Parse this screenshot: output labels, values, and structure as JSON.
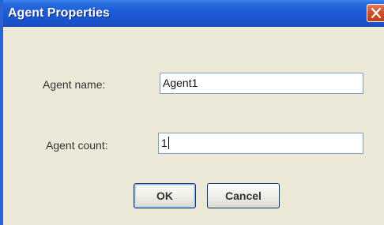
{
  "window": {
    "title": "Agent Properties",
    "close_icon": "close-x-icon"
  },
  "form": {
    "name_label": "Agent name:",
    "name_value": "Agent1",
    "count_label": "Agent count:",
    "count_value": "1"
  },
  "buttons": {
    "ok_label": "OK",
    "cancel_label": "Cancel"
  }
}
